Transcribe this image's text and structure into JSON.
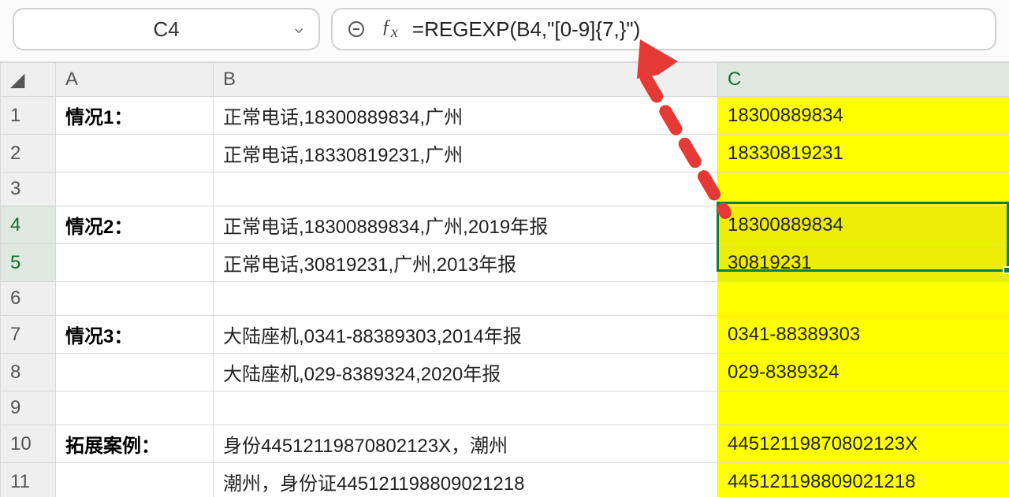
{
  "namebox": {
    "value": "C4"
  },
  "formula_bar": {
    "formula": "=REGEXP(B4,\"[0-9]{7,}\")"
  },
  "columns": {
    "A": "A",
    "B": "B",
    "C": "C"
  },
  "selection": {
    "range": "C4:C5",
    "active_rows": [
      "4",
      "5"
    ],
    "active_cols": [
      "C"
    ]
  },
  "rows": {
    "1": {
      "A": "情况1：",
      "B": "正常电话,18300889834,广州",
      "C": "18300889834"
    },
    "2": {
      "A": "",
      "B": "正常电话,18330819231,广州",
      "C": "18330819231"
    },
    "3": {
      "A": "",
      "B": "",
      "C": ""
    },
    "4": {
      "A": "情况2：",
      "B": "正常电话,18300889834,广州,2019年报",
      "C": "18300889834"
    },
    "5": {
      "A": "",
      "B": "正常电话,30819231,广州,2013年报",
      "C": "30819231"
    },
    "6": {
      "A": "",
      "B": "",
      "C": ""
    },
    "7": {
      "A": "情况3：",
      "B": "大陆座机,0341-88389303,2014年报",
      "C": "0341-88389303"
    },
    "8": {
      "A": "",
      "B": "大陆座机,029-8389324,2020年报",
      "C": "029-8389324"
    },
    "9": {
      "A": "",
      "B": "",
      "C": ""
    },
    "10": {
      "A": "拓展案例：",
      "B": "身份44512119870802123X，潮州",
      "C": "44512119870802123X"
    },
    "11": {
      "A": "",
      "B": "潮州，身份证445121198809021218",
      "C": "445121198809021218"
    }
  },
  "highlight": {
    "yellow_cells": [
      "C1",
      "C2",
      "C3",
      "C4",
      "C5",
      "C6",
      "C7",
      "C8",
      "C9",
      "C10",
      "C11"
    ]
  }
}
